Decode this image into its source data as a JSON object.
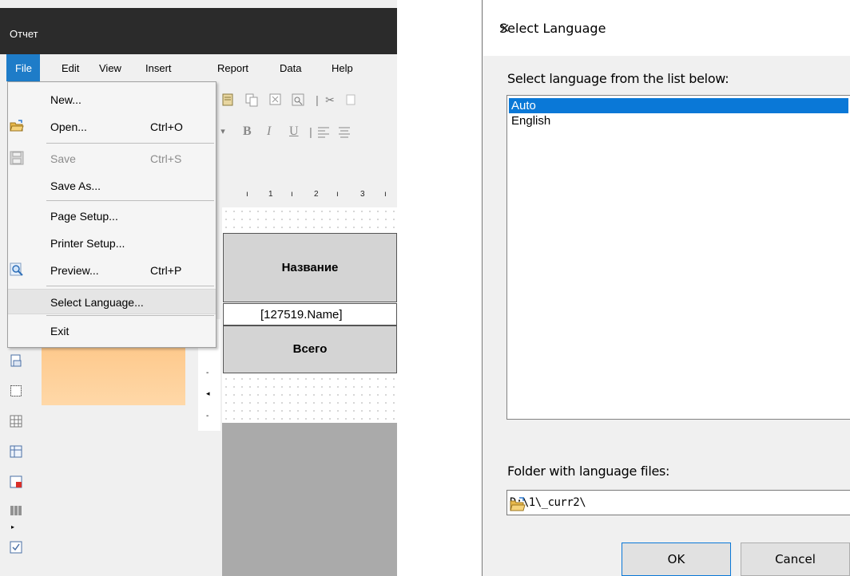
{
  "designer": {
    "window_title": "Отчет",
    "menu": {
      "file": "File",
      "edit": "Edit",
      "view": "View",
      "insert": "Insert",
      "report": "Report",
      "data": "Data",
      "help": "Help"
    },
    "file_menu": {
      "new": "New...",
      "open": "Open...",
      "open_shortcut": "Ctrl+O",
      "save": "Save",
      "save_shortcut": "Ctrl+S",
      "save_as": "Save As...",
      "page_setup": "Page Setup...",
      "printer_setup": "Printer Setup...",
      "preview": "Preview...",
      "preview_shortcut": "Ctrl+P",
      "select_language": "Select Language...",
      "exit": "Exit"
    },
    "toolbar": {
      "bold": "B",
      "italic": "I",
      "underline": "U"
    },
    "ruler": [
      "1",
      "2",
      "3"
    ],
    "report": {
      "header_text": "Название",
      "data_field": "[127519.Name]",
      "total_text": "Всего"
    }
  },
  "dialog": {
    "title": "Select Language",
    "close_glyph": "✕",
    "prompt": "Select language from the list below:",
    "languages": [
      {
        "label": "Auto",
        "selected": true
      },
      {
        "label": "English",
        "selected": false
      }
    ],
    "folder_label": "Folder with language files:",
    "folder_value": "D:\\1\\_curr2\\",
    "ok_label": "OK",
    "cancel_label": "Cancel"
  },
  "colors": {
    "selection": "#0a78d7",
    "titlebar": "#2b2b2b",
    "menu_active": "#1e7cc8"
  }
}
